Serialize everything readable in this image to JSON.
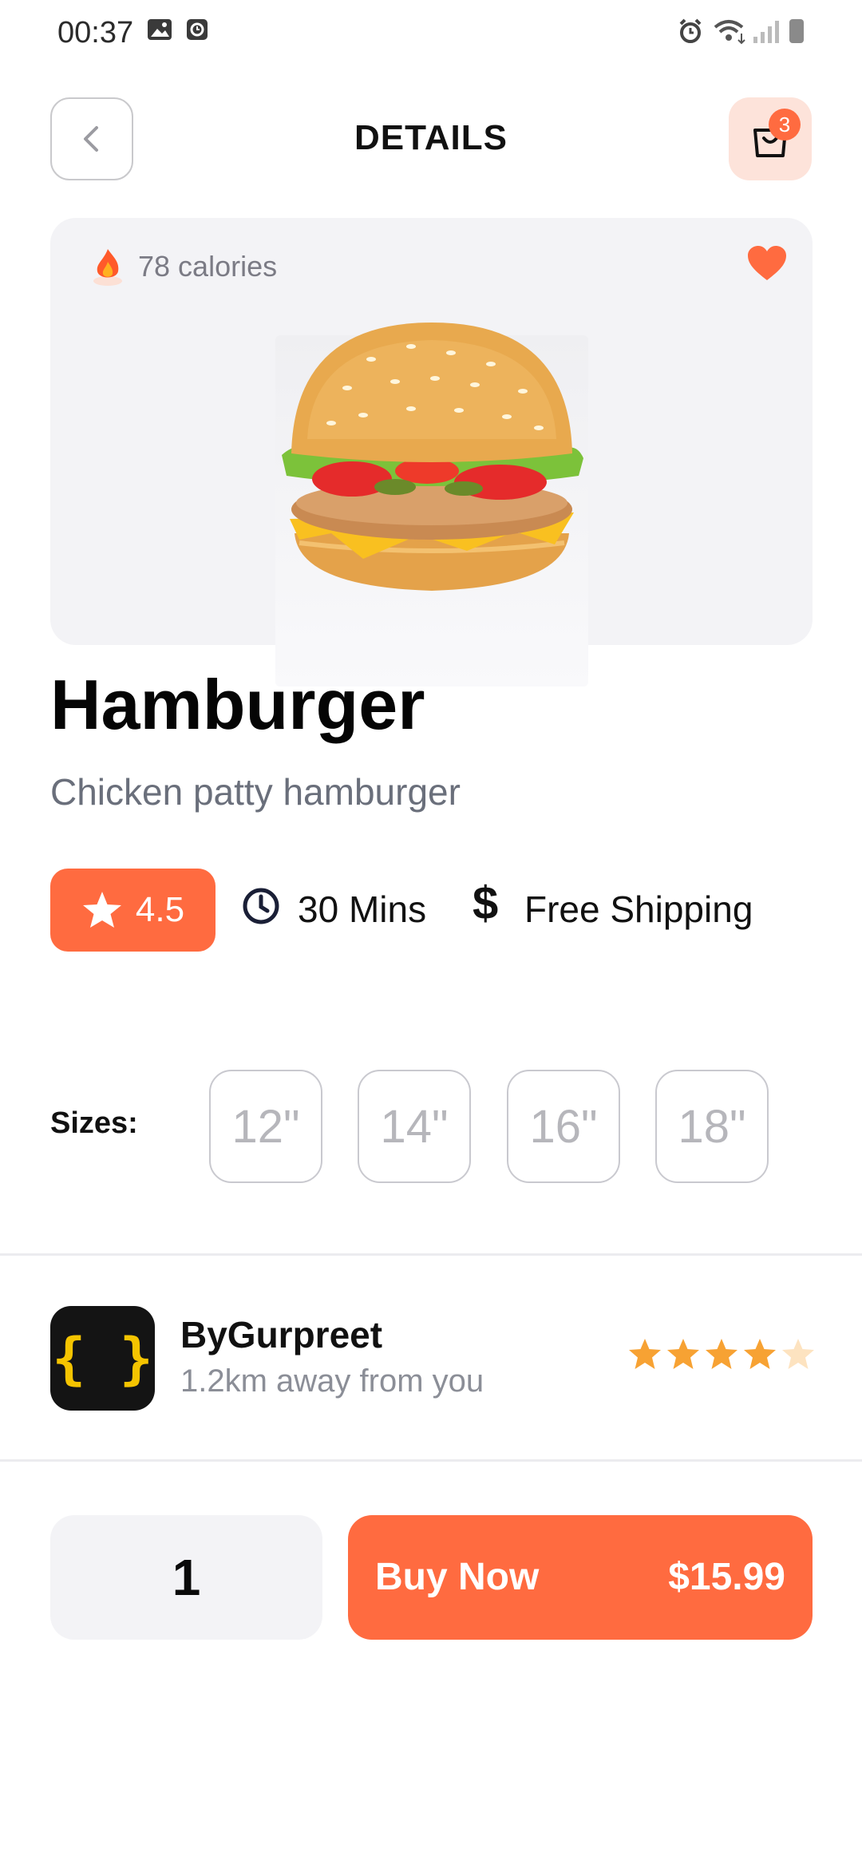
{
  "status_bar": {
    "time": "00:37"
  },
  "header": {
    "title": "DETAILS",
    "cart_count": "3"
  },
  "hero": {
    "calories": "78 calories"
  },
  "product": {
    "name": "Hamburger",
    "description": "Chicken patty hamburger",
    "rating": "4.5",
    "time": "30 Mins",
    "shipping": "Free Shipping"
  },
  "sizes": {
    "label": "Sizes:",
    "options": [
      "12\"",
      "14\"",
      "16\"",
      "18\""
    ]
  },
  "seller": {
    "logo_text": "{ }",
    "name": "ByGurpreet",
    "distance": "1.2km away from you",
    "stars": 4.5
  },
  "purchase": {
    "quantity": "1",
    "buy_label": "Buy Now",
    "price": "$15.99"
  },
  "colors": {
    "accent": "#ff6b40",
    "accent_light": "#fde3da",
    "star": "#f7a233"
  }
}
